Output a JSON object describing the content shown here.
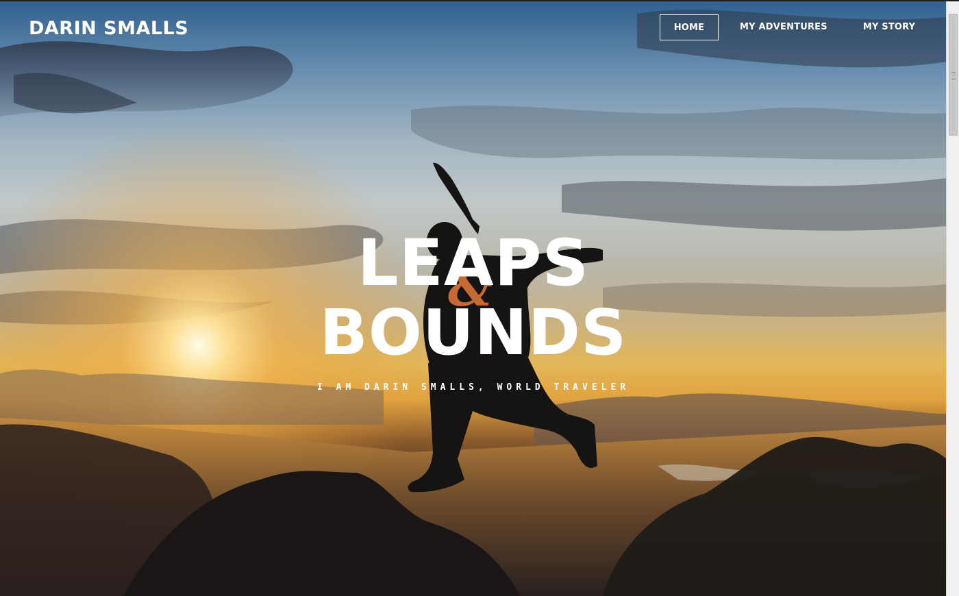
{
  "site": {
    "brand": "DARIN SMALLS"
  },
  "nav": {
    "items": [
      {
        "label": "HOME",
        "active": true
      },
      {
        "label": "MY ADVENTURES",
        "active": false
      },
      {
        "label": "MY STORY",
        "active": false
      }
    ]
  },
  "hero": {
    "title_line1": "LEAPS",
    "ampersand": "&",
    "title_line2": "BOUNDS",
    "subtitle": "I AM DARIN SMALLS, WORLD TRAVELER"
  },
  "colors": {
    "accent": "#c56a33",
    "text": "#ffffff"
  }
}
